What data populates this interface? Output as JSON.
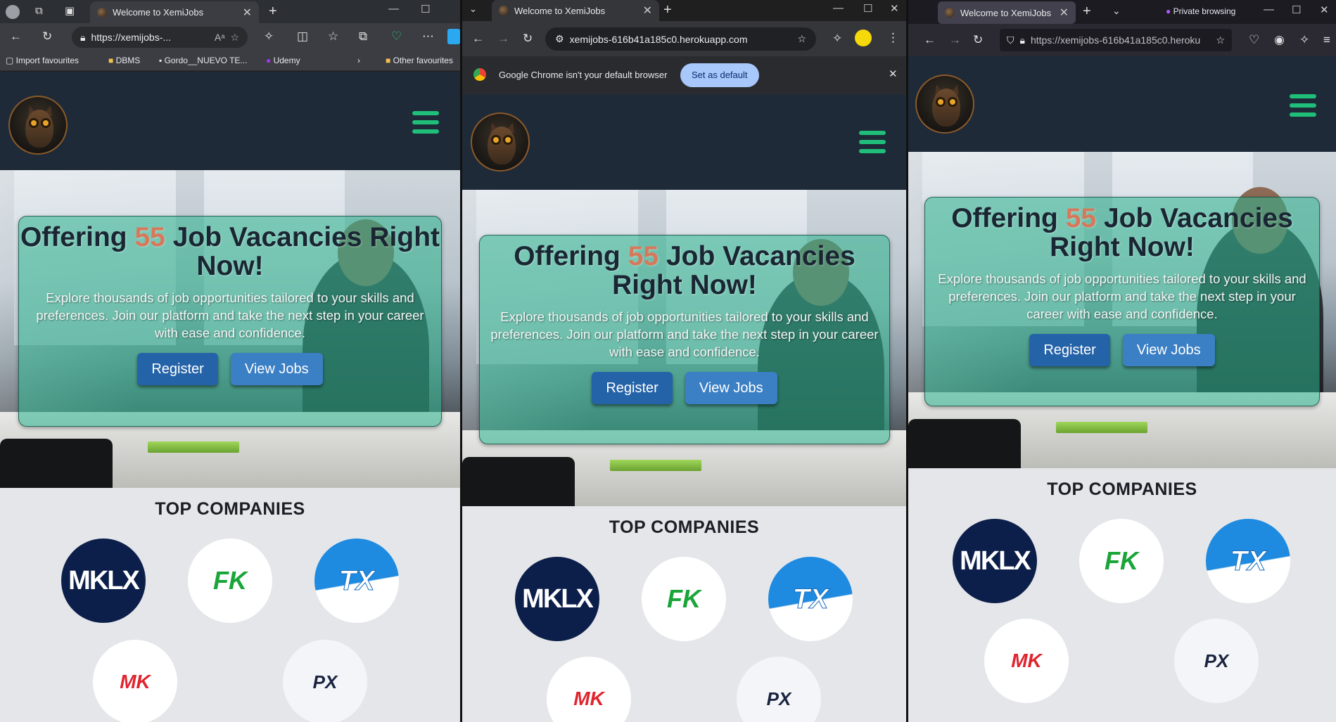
{
  "edge": {
    "tab_title": "Welcome to XemiJobs",
    "url": "https://xemijobs-...",
    "bookmarks": [
      "Import favourites",
      "DBMS",
      "Gordo__NUEVO TE...",
      "Udemy"
    ],
    "other_favourites": "Other favourites"
  },
  "chrome": {
    "tab_title": "Welcome to XemiJobs",
    "url": "xemijobs-616b41a185c0.herokuapp.com",
    "infobar_text": "Google Chrome isn't your default browser",
    "set_default_label": "Set as default"
  },
  "firefox": {
    "tab_title": "Welcome to XemiJobs",
    "private_label": "Private browsing",
    "url": "https://xemijobs-616b41a185c0.heroku"
  },
  "site": {
    "hero_title_prefix": "Offering",
    "vacancies": "55",
    "hero_title_suffix": "Job Vacancies Right Now!",
    "hero_text": "Explore thousands of job opportunities tailored to your skills and preferences. Join our platform and take the next step in your career with ease and confidence.",
    "register_label": "Register",
    "view_jobs_label": "View Jobs",
    "companies_title": "TOP COMPANIES",
    "companies": [
      "MKLX",
      "FK",
      "TX",
      "MK",
      "PX"
    ]
  },
  "colors": {
    "nav_bg": "#1f2a38",
    "burger": "#1fbf7a",
    "accent_number": "#d8785a",
    "card_overlay": "#2ab28c",
    "register_btn": "#2563a8",
    "viewjobs_btn": "#3b7fc4"
  }
}
